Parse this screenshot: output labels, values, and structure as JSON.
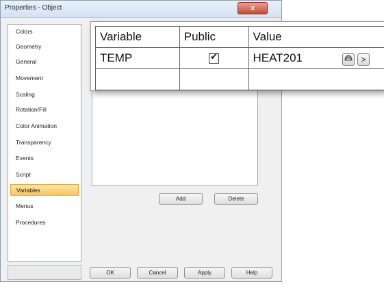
{
  "window": {
    "title": "Properties - Object",
    "close_label": "x"
  },
  "sidebar": {
    "items": [
      {
        "label": "Colors"
      },
      {
        "label": "Geometry"
      },
      {
        "label": "General"
      },
      {
        "label": "Movement"
      },
      {
        "label": "Scaling"
      },
      {
        "label": "Rotation/Fill"
      },
      {
        "label": "Color Animation"
      },
      {
        "label": "Transparency"
      },
      {
        "label": "Events"
      },
      {
        "label": "Script"
      },
      {
        "label": "Variables",
        "selected": true
      },
      {
        "label": "Menus"
      },
      {
        "label": "Procedures"
      }
    ]
  },
  "variables_panel": {
    "add_label": "Add",
    "delete_label": "Delete"
  },
  "footer": {
    "ok_label": "OK",
    "cancel_label": "Cancel",
    "apply_label": "Apply",
    "help_label": "Help"
  },
  "grid": {
    "headers": {
      "variable": "Variable",
      "public": "Public",
      "value": "Value"
    },
    "rows": [
      {
        "variable": "TEMP",
        "public": true,
        "value": "HEAT201"
      }
    ],
    "browse_button_label": ">"
  },
  "colors": {
    "selected_item": "#f9c45d",
    "close_button": "#c84a32"
  }
}
